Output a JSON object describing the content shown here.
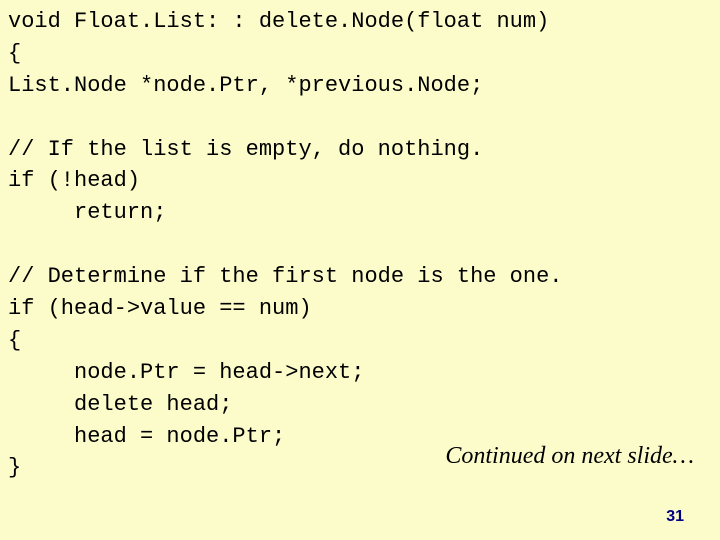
{
  "code": "void Float.List: : delete.Node(float num)\n{\nList.Node *node.Ptr, *previous.Node;\n\n// If the list is empty, do nothing.\nif (!head)\n     return;\n\n// Determine if the first node is the one.\nif (head->value == num)\n{\n     node.Ptr = head->next;\n     delete head;\n     head = node.Ptr;\n}",
  "continued": "Continued on next slide…",
  "page_number": "31"
}
